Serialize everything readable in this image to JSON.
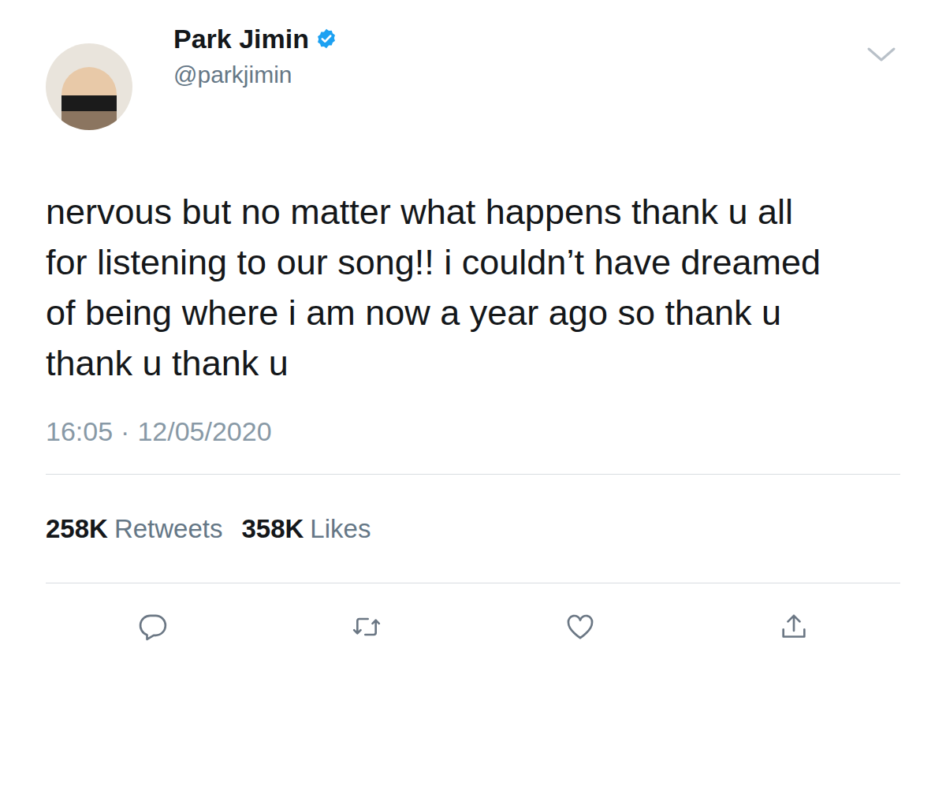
{
  "tweet": {
    "author": {
      "name": "Park Jimin",
      "handle": "@parkjimin",
      "verified": true
    },
    "text": "nervous but no matter what happens thank u all for listening to our song!! i couldn’t have dreamed of being where i am now a year ago so thank u thank u thank u",
    "time": "16:05",
    "separator": "·",
    "date": "12/05/2020"
  },
  "stats": [
    {
      "count": "258K",
      "label": "Retweets"
    },
    {
      "count": "358K",
      "label": "Likes"
    }
  ],
  "actions": [
    {
      "kind": "reply"
    },
    {
      "kind": "retweet"
    },
    {
      "kind": "like"
    },
    {
      "kind": "share"
    }
  ]
}
